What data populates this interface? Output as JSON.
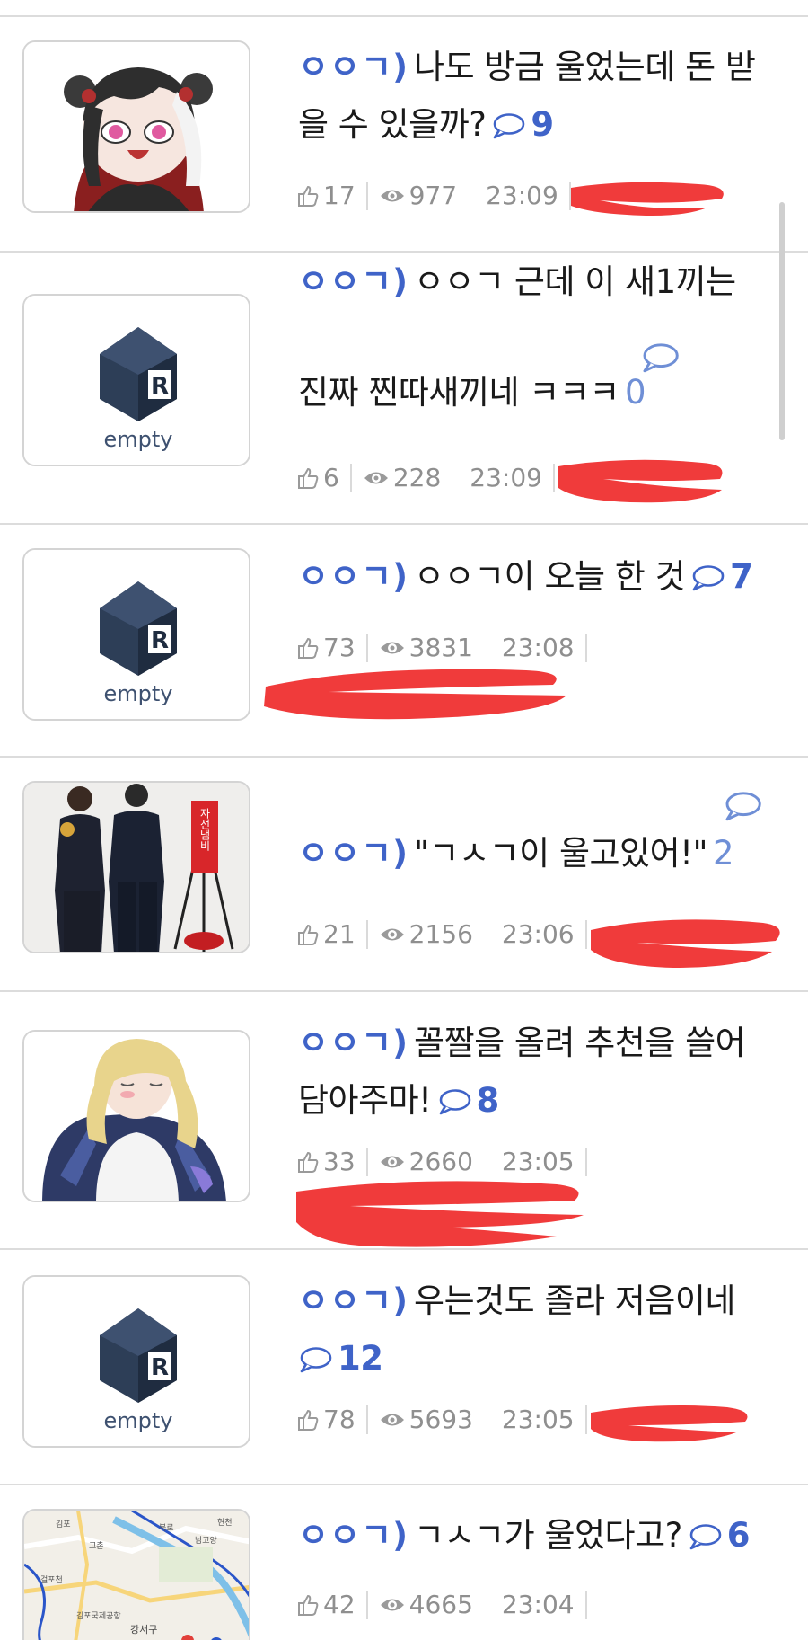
{
  "colors": {
    "accent": "#3f63c8",
    "meta_text": "#8f8f8f",
    "divider": "#dcdcdc",
    "redaction": "#f03b3b"
  },
  "icons": {
    "like": "thumbs-up-icon",
    "views": "eye-icon",
    "comments": "speech-bubble-icon"
  },
  "posts": [
    {
      "thumb": "anime-girl-illustration",
      "prefix": "ㅇㅇㄱ)",
      "title_lines": [
        "나도 방금 울었는데 돈 받",
        "을 수 있을까?"
      ],
      "comments": "9",
      "likes": "17",
      "views": "977",
      "time": "23:09"
    },
    {
      "thumb": "empty",
      "empty_label": "empty",
      "prefix": "ㅇㅇㄱ)",
      "title_lines": [
        "ㅇㅇㄱ 근데 이 새1끼는",
        "진짜 찐따새끼네 ㅋㅋㅋ"
      ],
      "comments": "0",
      "likes": "6",
      "views": "228",
      "time": "23:09"
    },
    {
      "thumb": "empty",
      "empty_label": "empty",
      "prefix": "ㅇㅇㄱ)",
      "title_lines": [
        "ㅇㅇㄱ이 오늘 한 것"
      ],
      "comments": "7",
      "likes": "73",
      "views": "3831",
      "time": "23:08"
    },
    {
      "thumb": "charity-bell-photo",
      "kettle_sign": "자선냄비",
      "prefix": "ㅇㅇㄱ)",
      "title_lines": [
        "\"ㄱㅅㄱ이 울고있어!\""
      ],
      "comments": "2",
      "likes": "21",
      "views": "2156",
      "time": "23:06"
    },
    {
      "thumb": "blonde-anime-illustration",
      "prefix": "ㅇㅇㄱ)",
      "title_lines": [
        "꼴짤을 올려 추천을 쓸어",
        "담아주마!"
      ],
      "comments": "8",
      "likes": "33",
      "views": "2660",
      "time": "23:05"
    },
    {
      "thumb": "empty",
      "empty_label": "empty",
      "prefix": "ㅇㅇㄱ)",
      "title_lines": [
        "우는것도 졸라 저음이네"
      ],
      "comments": "12",
      "likes": "78",
      "views": "5693",
      "time": "23:05"
    },
    {
      "thumb": "map",
      "map_labels": [
        "김포",
        "고촌",
        "걸포천",
        "김포국제공항",
        "강서구",
        "북로",
        "남고양",
        "현천"
      ],
      "prefix": "ㅇㅇㄱ)",
      "title_lines": [
        "ㄱㅅㄱ가 울었다고?"
      ],
      "comments": "6",
      "likes": "42",
      "views": "4665",
      "time": "23:04"
    }
  ]
}
